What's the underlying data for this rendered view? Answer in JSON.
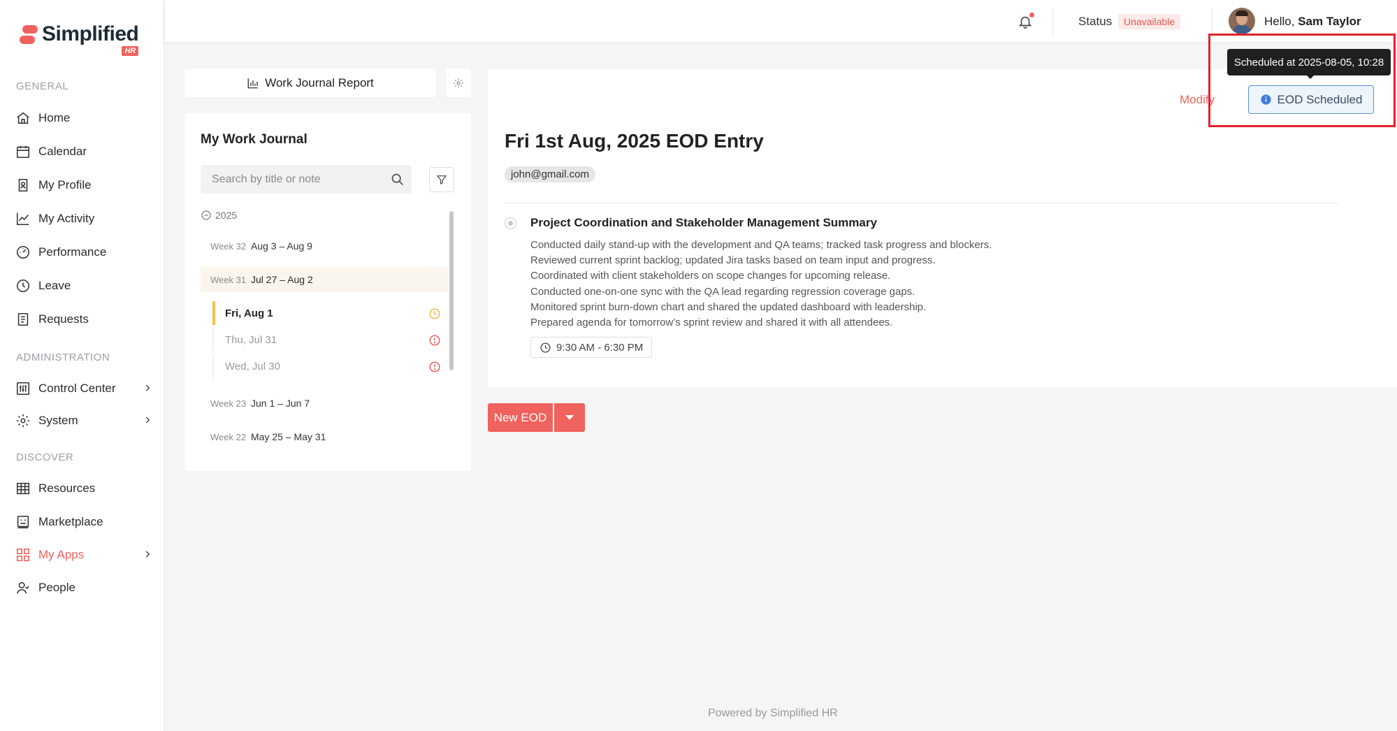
{
  "brand": {
    "name": "Simplified",
    "badge": "HR"
  },
  "sidebar": {
    "sections": {
      "general": "GENERAL",
      "administration": "ADMINISTRATION",
      "discover": "DISCOVER"
    },
    "items": [
      {
        "label": "Home",
        "icon": "home-icon"
      },
      {
        "label": "Calendar",
        "icon": "calendar-icon"
      },
      {
        "label": "My Profile",
        "icon": "profile-icon"
      },
      {
        "label": "My Activity",
        "icon": "activity-icon"
      },
      {
        "label": "Performance",
        "icon": "gauge-icon"
      },
      {
        "label": "Leave",
        "icon": "clock-icon"
      },
      {
        "label": "Requests",
        "icon": "document-icon"
      },
      {
        "label": "Control Center",
        "icon": "sliders-icon"
      },
      {
        "label": "System",
        "icon": "gear-icon"
      },
      {
        "label": "Resources",
        "icon": "table-icon"
      },
      {
        "label": "Marketplace",
        "icon": "store-icon"
      },
      {
        "label": "My Apps",
        "icon": "grid-icon"
      },
      {
        "label": "People",
        "icon": "person-icon"
      }
    ]
  },
  "header": {
    "status_label": "Status",
    "status_value": "Unavailable",
    "greeting": "Hello,",
    "user_name": "Sam Taylor"
  },
  "journal": {
    "report_button": "Work Journal Report",
    "title": "My Work Journal",
    "search_placeholder": "Search by title or note",
    "year": "2025",
    "weeks": [
      {
        "week": "Week 32",
        "range": "Aug 3 – Aug 9"
      },
      {
        "week": "Week 31",
        "range": "Jul 27 – Aug 2"
      },
      {
        "week": "Week 23",
        "range": "Jun 1 – Jun 7"
      },
      {
        "week": "Week 22",
        "range": "May 25 – May 31"
      }
    ],
    "days": [
      {
        "label": "Fri, Aug 1",
        "status": "scheduled"
      },
      {
        "label": "Thu, Jul 31",
        "status": "missing"
      },
      {
        "label": "Wed, Jul 30",
        "status": "missing"
      }
    ]
  },
  "entry": {
    "modify_label": "Modify",
    "status_button": "EOD Scheduled",
    "tooltip": "Scheduled at 2025-08-05, 10:28",
    "title": "Fri 1st Aug, 2025 EOD Entry",
    "email": "john@gmail.com",
    "task_title": "Project Coordination and Stakeholder Management Summary",
    "task_lines": [
      "Conducted daily stand-up with the development and QA teams; tracked task progress and blockers.",
      "Reviewed current sprint backlog; updated Jira tasks based on team input and progress.",
      "Coordinated with client stakeholders on scope changes for upcoming release.",
      "Conducted one-on-one sync with the QA lead regarding regression coverage gaps.",
      "Monitored sprint burn-down chart and shared the updated dashboard with leadership.",
      "Prepared agenda for tomorrow’s sprint review and shared it with all attendees."
    ],
    "time_range": "9:30 AM - 6:30 PM"
  },
  "actions": {
    "new_eod": "New EOD"
  },
  "footer": "Powered by Simplified HR",
  "colors": {
    "accent": "#f0625d",
    "info": "#5b8fd8",
    "highlight": "#e3202c"
  }
}
